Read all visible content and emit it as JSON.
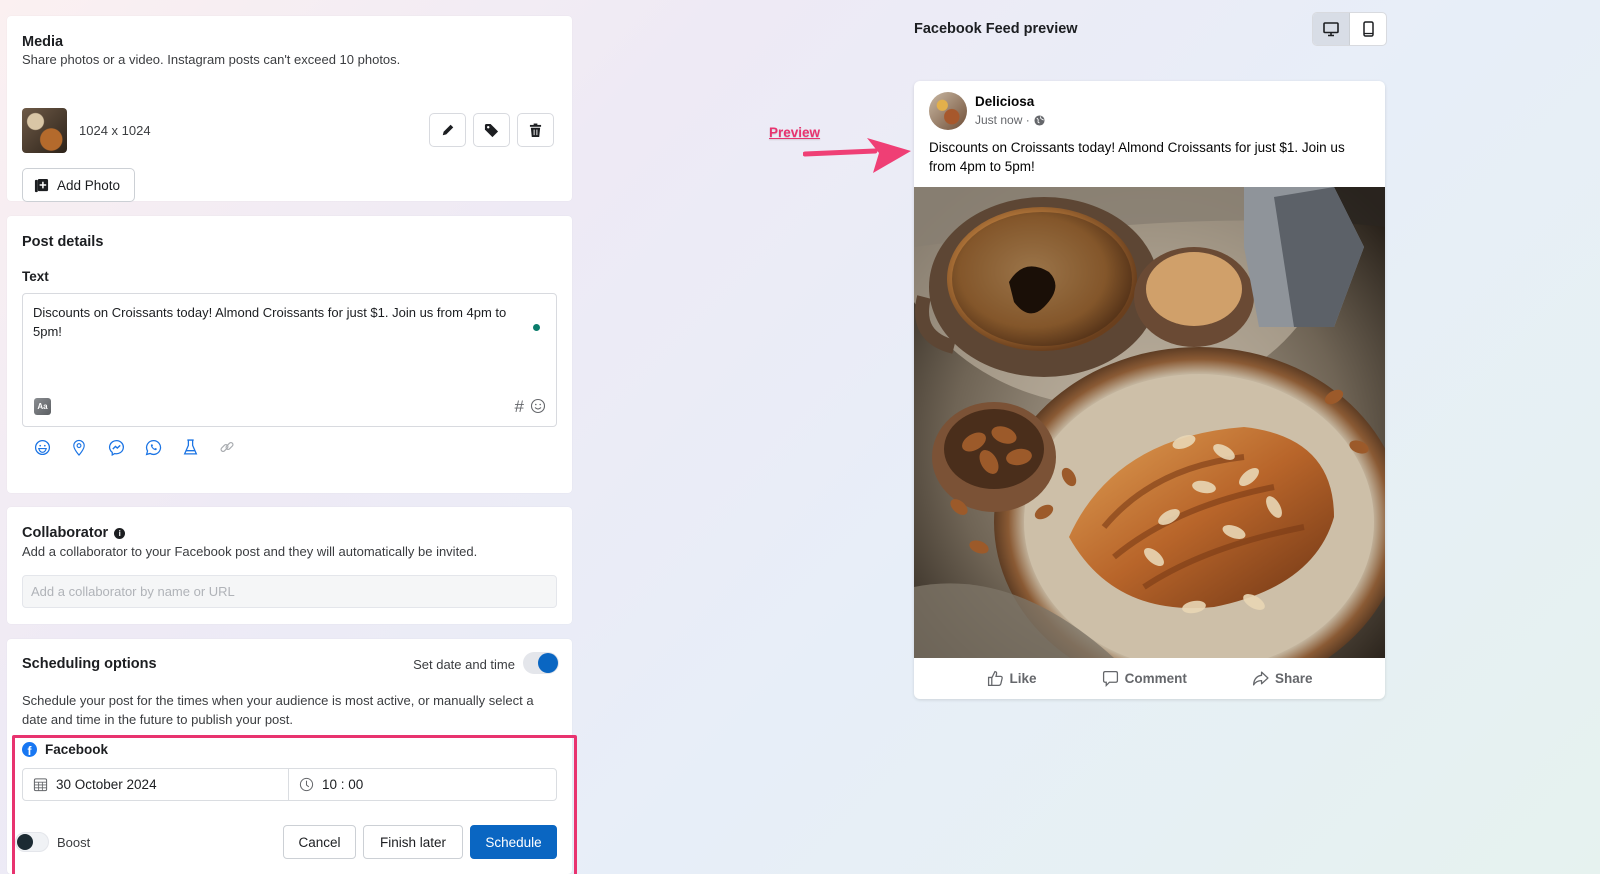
{
  "media": {
    "title": "Media",
    "subtitle": "Share photos or a video. Instagram posts can't exceed 10 photos.",
    "image_dimensions": "1024 x 1024",
    "actions": [
      "edit-icon",
      "tag-icon",
      "trash-icon"
    ],
    "add_photo_label": "Add Photo"
  },
  "post_details": {
    "title": "Post details",
    "text_label": "Text",
    "text_value": "Discounts on Croissants today! Almond Croissants for just $1. Join us from 4pm to 5pm!",
    "text_tools": [
      "format-icon",
      "hashtag-icon",
      "emoji-icon"
    ],
    "toolbar": [
      "feeling-icon",
      "location-icon",
      "messenger-icon",
      "whatsapp-icon",
      "test-icon",
      "link-icon"
    ]
  },
  "collaborator": {
    "title": "Collaborator",
    "subtitle": "Add a collaborator to your Facebook post and they will automatically be invited.",
    "placeholder": "Add a collaborator by name or URL"
  },
  "scheduling": {
    "title": "Scheduling options",
    "toggle_label": "Set date and time",
    "toggle_on": true,
    "description": "Schedule your post for the times when your audience is most active, or manually select a date and time in the future to publish your post.",
    "platform": "Facebook",
    "date": "30 October 2024",
    "time": "10 : 00",
    "boost_label": "Boost",
    "boost_on": false,
    "cancel_label": "Cancel",
    "finish_later_label": "Finish later",
    "schedule_label": "Schedule"
  },
  "preview": {
    "title": "Facebook Feed preview",
    "device_modes": [
      "desktop",
      "mobile"
    ],
    "active_device": "desktop",
    "annotation_label": "Preview",
    "page_name": "Deliciosa",
    "timestamp": "Just now ·",
    "post_text": "Discounts on Croissants today! Almond Croissants for just $1. Join us from 4pm to 5pm!",
    "actions": {
      "like": "Like",
      "comment": "Comment",
      "share": "Share"
    }
  },
  "colors": {
    "accent": "#0a66c2",
    "highlight": "#e8336f",
    "facebook": "#1877f2"
  }
}
